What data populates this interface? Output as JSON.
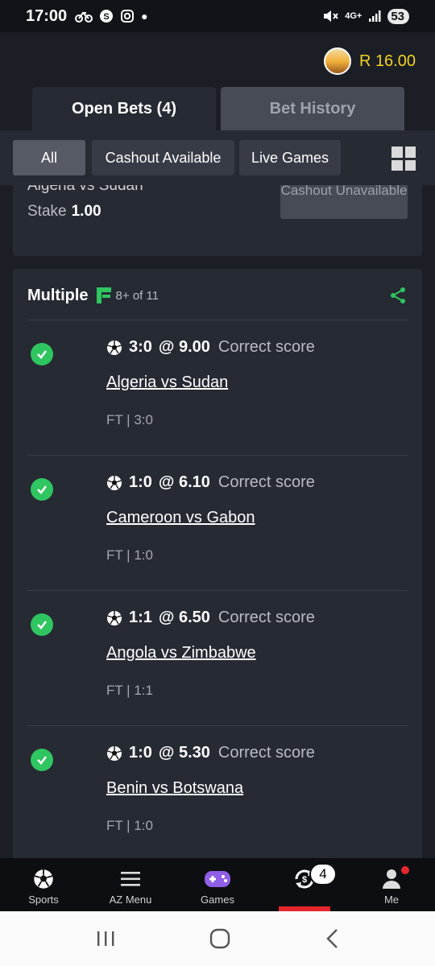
{
  "status_bar": {
    "time": "17:00",
    "network": "4G+",
    "battery": "53"
  },
  "header": {
    "balance": "R 16.00"
  },
  "tabs": [
    {
      "label": "Open Bets (4)",
      "active": true
    },
    {
      "label": "Bet History",
      "active": false
    }
  ],
  "filters": [
    {
      "label": "All",
      "active": true
    },
    {
      "label": "Cashout Available",
      "active": false
    },
    {
      "label": "Live Games",
      "active": false
    }
  ],
  "previous_bet": {
    "match": "Algeria vs Sudan",
    "stake_label": "Stake",
    "stake_value": "1.00",
    "cashout_label": "Cashout Unavailable"
  },
  "multiple": {
    "title": "Multiple",
    "flexi_text": "8+ of 11",
    "legs": [
      {
        "pick": "3:0",
        "odds": "@ 9.00",
        "market": "Correct score",
        "match": "Algeria vs Sudan",
        "result": "FT  | 3:0"
      },
      {
        "pick": "1:0",
        "odds": "@ 6.10",
        "market": "Correct score",
        "match": "Cameroon vs Gabon",
        "result": "FT  | 1:0"
      },
      {
        "pick": "1:1",
        "odds": "@ 6.50",
        "market": "Correct score",
        "match": "Angola vs Zimbabwe",
        "result": "FT  | 1:1"
      },
      {
        "pick": "1:0",
        "odds": "@ 5.30",
        "market": "Correct score",
        "match": "Benin vs Botswana",
        "result": "FT  | 1:0"
      }
    ]
  },
  "bottom_nav": {
    "sports": "Sports",
    "az_menu": "AZ Menu",
    "games": "Games",
    "open_bets_count": "4",
    "me": "Me"
  },
  "colors": {
    "accent_green": "#2fc560",
    "balance_yellow": "#f5d21f",
    "active_red": "#e5272d"
  }
}
